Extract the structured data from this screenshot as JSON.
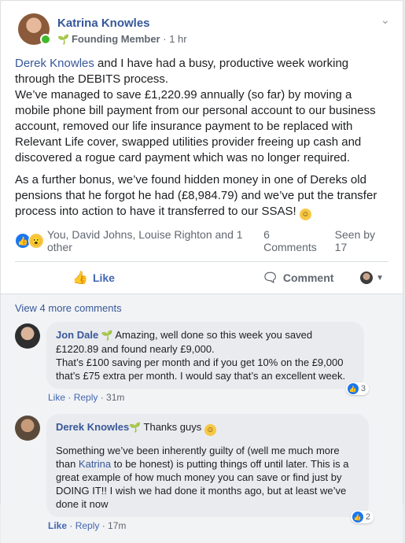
{
  "post": {
    "author": "Katrina Knowles",
    "badge": "Founding Member",
    "time": "1 hr",
    "mention": "Derek Knowles",
    "para1_rest": " and I have had a busy, productive week working through the DEBITS process.",
    "para1_line2": "We’ve managed to save £1,220.99 annually (so far) by moving a mobile phone bill payment from our personal account to our business account, removed our life insurance payment to be replaced with Relevant Life cover, swapped utilities provider freeing up cash and discovered a rogue card payment which was no longer required.",
    "para2": "As a further bonus, we’ve found hidden money in one of Dereks old pensions that he forgot he had (£8,984.79) and we’ve put the transfer process into action to have it transferred to our SSAS! ",
    "reactors": "You, David Johns, Louise Righton and 1 other",
    "comments_count": "6 Comments",
    "seen_by": "Seen by 17"
  },
  "actions": {
    "like_label": "Like",
    "comment_label": "Comment"
  },
  "comments": {
    "view_more": "View 4 more comments",
    "items": [
      {
        "author": "Jon Dale",
        "line1": " Amazing, well done so this week you saved £1220.89 and found nearly £9,000.",
        "line2": "That’s £100 saving per month and if you get 10% on the £9,000 that’s £75 extra per month. I would say that’s an excellent week.",
        "like": "Like",
        "reply": "Reply",
        "time": "31m",
        "reaction_count": "3"
      },
      {
        "author": "Derek Knowles",
        "line1": " Thanks guys ",
        "line2_pre": "Something we’ve been inherently guilty of (well me much more than ",
        "line2_mention": "Katrina",
        "line2_post": " to be honest) is putting things off until later. This is a great example of how much money you can save or find just by DOING IT!! I wish we had done it months ago, but at least we’ve done it now",
        "like": "Like",
        "reply": "Reply",
        "time": "17m",
        "reaction_count": "2"
      }
    ]
  }
}
